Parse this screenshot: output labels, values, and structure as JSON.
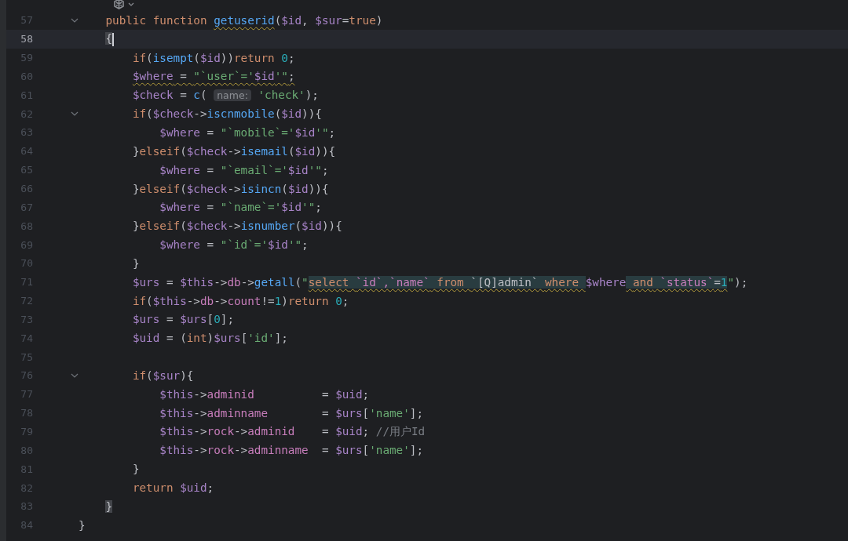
{
  "editor": {
    "lines": [
      {
        "number": "57",
        "current": false,
        "foldable": true,
        "tokens": [
          {
            "kind": "kw",
            "text": "    public function "
          },
          {
            "kind": "squiggle",
            "tokens": [
              {
                "kind": "fn",
                "text": "getuserid"
              }
            ]
          },
          {
            "kind": "plain",
            "text": "("
          },
          {
            "kind": "var",
            "text": "$id"
          },
          {
            "kind": "plain",
            "text": ", "
          },
          {
            "kind": "var",
            "text": "$sur"
          },
          {
            "kind": "plain",
            "text": "="
          },
          {
            "kind": "kw",
            "text": "true"
          },
          {
            "kind": "plain",
            "text": ")"
          }
        ]
      },
      {
        "number": "58",
        "current": true,
        "foldable": false,
        "tokens": [
          {
            "kind": "brace",
            "text": "    {"
          }
        ]
      },
      {
        "number": "59",
        "current": false,
        "foldable": false,
        "tokens": [
          {
            "kind": "kw",
            "text": "        if"
          },
          {
            "kind": "plain",
            "text": "("
          },
          {
            "kind": "fn",
            "text": "isempt"
          },
          {
            "kind": "plain",
            "text": "("
          },
          {
            "kind": "var",
            "text": "$id"
          },
          {
            "kind": "plain",
            "text": "))"
          },
          {
            "kind": "kw",
            "text": "return "
          },
          {
            "kind": "num",
            "text": "0"
          },
          {
            "kind": "plain",
            "text": ";"
          }
        ]
      },
      {
        "number": "60",
        "current": false,
        "foldable": false,
        "tokens": [
          {
            "kind": "squiggle",
            "tokens": [
              {
                "kind": "var",
                "text": "        $where"
              },
              {
                "kind": "plain",
                "text": " = "
              },
              {
                "kind": "str",
                "text": "\"`user`='"
              },
              {
                "kind": "var",
                "text": "$id"
              },
              {
                "kind": "str",
                "text": "'\""
              },
              {
                "kind": "plain",
                "text": ";"
              }
            ]
          }
        ]
      },
      {
        "number": "61",
        "current": false,
        "foldable": false,
        "tokens": [
          {
            "kind": "var",
            "text": "        $check"
          },
          {
            "kind": "plain",
            "text": " = "
          },
          {
            "kind": "fn",
            "text": "c"
          },
          {
            "kind": "plain",
            "text": "( "
          },
          {
            "kind": "hint",
            "text": "name:"
          },
          {
            "kind": "str",
            "text": " 'check'"
          },
          {
            "kind": "plain",
            "text": ");"
          }
        ]
      },
      {
        "number": "62",
        "current": false,
        "foldable": true,
        "tokens": [
          {
            "kind": "kw",
            "text": "        if"
          },
          {
            "kind": "plain",
            "text": "("
          },
          {
            "kind": "var",
            "text": "$check"
          },
          {
            "kind": "plain",
            "text": "->"
          },
          {
            "kind": "fn",
            "text": "iscnmobile"
          },
          {
            "kind": "plain",
            "text": "("
          },
          {
            "kind": "var",
            "text": "$id"
          },
          {
            "kind": "plain",
            "text": ")){"
          }
        ]
      },
      {
        "number": "63",
        "current": false,
        "foldable": false,
        "tokens": [
          {
            "kind": "var",
            "text": "            $where"
          },
          {
            "kind": "plain",
            "text": " = "
          },
          {
            "kind": "str",
            "text": "\"`mobile`='"
          },
          {
            "kind": "var",
            "text": "$id"
          },
          {
            "kind": "str",
            "text": "'\""
          },
          {
            "kind": "plain",
            "text": ";"
          }
        ]
      },
      {
        "number": "64",
        "current": false,
        "foldable": false,
        "tokens": [
          {
            "kind": "plain",
            "text": "        }"
          },
          {
            "kind": "kw",
            "text": "elseif"
          },
          {
            "kind": "plain",
            "text": "("
          },
          {
            "kind": "var",
            "text": "$check"
          },
          {
            "kind": "plain",
            "text": "->"
          },
          {
            "kind": "fn",
            "text": "isemail"
          },
          {
            "kind": "plain",
            "text": "("
          },
          {
            "kind": "var",
            "text": "$id"
          },
          {
            "kind": "plain",
            "text": ")){"
          }
        ]
      },
      {
        "number": "65",
        "current": false,
        "foldable": false,
        "tokens": [
          {
            "kind": "var",
            "text": "            $where"
          },
          {
            "kind": "plain",
            "text": " = "
          },
          {
            "kind": "str",
            "text": "\"`email`='"
          },
          {
            "kind": "var",
            "text": "$id"
          },
          {
            "kind": "str",
            "text": "'\""
          },
          {
            "kind": "plain",
            "text": ";"
          }
        ]
      },
      {
        "number": "66",
        "current": false,
        "foldable": false,
        "tokens": [
          {
            "kind": "plain",
            "text": "        }"
          },
          {
            "kind": "kw",
            "text": "elseif"
          },
          {
            "kind": "plain",
            "text": "("
          },
          {
            "kind": "var",
            "text": "$check"
          },
          {
            "kind": "plain",
            "text": "->"
          },
          {
            "kind": "fn",
            "text": "isincn"
          },
          {
            "kind": "plain",
            "text": "("
          },
          {
            "kind": "var",
            "text": "$id"
          },
          {
            "kind": "plain",
            "text": ")){"
          }
        ]
      },
      {
        "number": "67",
        "current": false,
        "foldable": false,
        "tokens": [
          {
            "kind": "var",
            "text": "            $where"
          },
          {
            "kind": "plain",
            "text": " = "
          },
          {
            "kind": "str",
            "text": "\"`name`='"
          },
          {
            "kind": "var",
            "text": "$id"
          },
          {
            "kind": "str",
            "text": "'\""
          },
          {
            "kind": "plain",
            "text": ";"
          }
        ]
      },
      {
        "number": "68",
        "current": false,
        "foldable": false,
        "tokens": [
          {
            "kind": "plain",
            "text": "        }"
          },
          {
            "kind": "kw",
            "text": "elseif"
          },
          {
            "kind": "plain",
            "text": "("
          },
          {
            "kind": "var",
            "text": "$check"
          },
          {
            "kind": "plain",
            "text": "->"
          },
          {
            "kind": "fn",
            "text": "isnumber"
          },
          {
            "kind": "plain",
            "text": "("
          },
          {
            "kind": "var",
            "text": "$id"
          },
          {
            "kind": "plain",
            "text": ")){"
          }
        ]
      },
      {
        "number": "69",
        "current": false,
        "foldable": false,
        "tokens": [
          {
            "kind": "var",
            "text": "            $where"
          },
          {
            "kind": "plain",
            "text": " = "
          },
          {
            "kind": "str",
            "text": "\"`id`='"
          },
          {
            "kind": "var",
            "text": "$id"
          },
          {
            "kind": "str",
            "text": "'\""
          },
          {
            "kind": "plain",
            "text": ";"
          }
        ]
      },
      {
        "number": "70",
        "current": false,
        "foldable": false,
        "tokens": [
          {
            "kind": "plain",
            "text": "        }"
          }
        ]
      },
      {
        "number": "71",
        "current": false,
        "foldable": false,
        "tokens": [
          {
            "kind": "var",
            "text": "        $urs"
          },
          {
            "kind": "plain",
            "text": " = "
          },
          {
            "kind": "var",
            "text": "$this"
          },
          {
            "kind": "plain",
            "text": "->"
          },
          {
            "kind": "prop",
            "text": "db"
          },
          {
            "kind": "plain",
            "text": "->"
          },
          {
            "kind": "fn",
            "text": "getall"
          },
          {
            "kind": "plain",
            "text": "("
          },
          {
            "kind": "str",
            "text": "\""
          },
          {
            "kind": "injection",
            "tokens": [
              {
                "kind": "kw",
                "text": "select"
              },
              {
                "kind": "prop",
                "text": " `id`,`name`"
              },
              {
                "kind": "kw",
                "text": " from"
              },
              {
                "kind": "plain",
                "text": " `[Q]admin` "
              },
              {
                "kind": "kw",
                "text": "where "
              }
            ]
          },
          {
            "kind": "var",
            "text": "$where"
          },
          {
            "kind": "injection",
            "tokens": [
              {
                "kind": "kw",
                "text": " and"
              },
              {
                "kind": "prop",
                "text": " `status`"
              },
              {
                "kind": "plain",
                "text": "="
              },
              {
                "kind": "num",
                "text": "1"
              }
            ]
          },
          {
            "kind": "str",
            "text": "\""
          },
          {
            "kind": "plain",
            "text": ");"
          }
        ]
      },
      {
        "number": "72",
        "current": false,
        "foldable": false,
        "tokens": [
          {
            "kind": "kw",
            "text": "        if"
          },
          {
            "kind": "plain",
            "text": "("
          },
          {
            "kind": "var",
            "text": "$this"
          },
          {
            "kind": "plain",
            "text": "->"
          },
          {
            "kind": "prop",
            "text": "db"
          },
          {
            "kind": "plain",
            "text": "->"
          },
          {
            "kind": "prop",
            "text": "count"
          },
          {
            "kind": "plain",
            "text": "!="
          },
          {
            "kind": "num",
            "text": "1"
          },
          {
            "kind": "plain",
            "text": ")"
          },
          {
            "kind": "kw",
            "text": "return "
          },
          {
            "kind": "num",
            "text": "0"
          },
          {
            "kind": "plain",
            "text": ";"
          }
        ]
      },
      {
        "number": "73",
        "current": false,
        "foldable": false,
        "tokens": [
          {
            "kind": "var",
            "text": "        $urs"
          },
          {
            "kind": "plain",
            "text": " = "
          },
          {
            "kind": "var",
            "text": "$urs"
          },
          {
            "kind": "plain",
            "text": "["
          },
          {
            "kind": "num",
            "text": "0"
          },
          {
            "kind": "plain",
            "text": "];"
          }
        ]
      },
      {
        "number": "74",
        "current": false,
        "foldable": false,
        "tokens": [
          {
            "kind": "var",
            "text": "        $uid"
          },
          {
            "kind": "plain",
            "text": " = ("
          },
          {
            "kind": "kw",
            "text": "int"
          },
          {
            "kind": "plain",
            "text": ")"
          },
          {
            "kind": "var",
            "text": "$urs"
          },
          {
            "kind": "plain",
            "text": "["
          },
          {
            "kind": "str",
            "text": "'id'"
          },
          {
            "kind": "plain",
            "text": "];"
          }
        ]
      },
      {
        "number": "75",
        "current": false,
        "foldable": false
      },
      {
        "number": "76",
        "current": false,
        "foldable": true,
        "tokens": [
          {
            "kind": "kw",
            "text": "        if"
          },
          {
            "kind": "plain",
            "text": "("
          },
          {
            "kind": "var",
            "text": "$sur"
          },
          {
            "kind": "plain",
            "text": "){"
          }
        ]
      },
      {
        "number": "77",
        "current": false,
        "foldable": false,
        "tokens": [
          {
            "kind": "var",
            "text": "            $this"
          },
          {
            "kind": "plain",
            "text": "->"
          },
          {
            "kind": "prop",
            "text": "adminid"
          },
          {
            "kind": "plain",
            "text": "          = "
          },
          {
            "kind": "var",
            "text": "$uid"
          },
          {
            "kind": "plain",
            "text": ";"
          }
        ]
      },
      {
        "number": "78",
        "current": false,
        "foldable": false,
        "tokens": [
          {
            "kind": "var",
            "text": "            $this"
          },
          {
            "kind": "plain",
            "text": "->"
          },
          {
            "kind": "prop",
            "text": "adminname"
          },
          {
            "kind": "plain",
            "text": "        = "
          },
          {
            "kind": "var",
            "text": "$urs"
          },
          {
            "kind": "plain",
            "text": "["
          },
          {
            "kind": "str",
            "text": "'name'"
          },
          {
            "kind": "plain",
            "text": "];"
          }
        ]
      },
      {
        "number": "79",
        "current": false,
        "foldable": false,
        "tokens": [
          {
            "kind": "var",
            "text": "            $this"
          },
          {
            "kind": "plain",
            "text": "->"
          },
          {
            "kind": "prop",
            "text": "rock"
          },
          {
            "kind": "plain",
            "text": "->"
          },
          {
            "kind": "prop",
            "text": "adminid"
          },
          {
            "kind": "plain",
            "text": "    = "
          },
          {
            "kind": "var",
            "text": "$uid"
          },
          {
            "kind": "plain",
            "text": "; "
          },
          {
            "kind": "comment",
            "text": "//用户Id"
          }
        ]
      },
      {
        "number": "80",
        "current": false,
        "foldable": false,
        "tokens": [
          {
            "kind": "var",
            "text": "            $this"
          },
          {
            "kind": "plain",
            "text": "->"
          },
          {
            "kind": "prop",
            "text": "rock"
          },
          {
            "kind": "plain",
            "text": "->"
          },
          {
            "kind": "prop",
            "text": "adminname"
          },
          {
            "kind": "plain",
            "text": "  = "
          },
          {
            "kind": "var",
            "text": "$urs"
          },
          {
            "kind": "plain",
            "text": "["
          },
          {
            "kind": "str",
            "text": "'name'"
          },
          {
            "kind": "plain",
            "text": "];"
          }
        ]
      },
      {
        "number": "81",
        "current": false,
        "foldable": false,
        "tokens": [
          {
            "kind": "plain",
            "text": "        }"
          }
        ]
      },
      {
        "number": "82",
        "current": false,
        "foldable": false,
        "tokens": [
          {
            "kind": "kw",
            "text": "        return "
          },
          {
            "kind": "var",
            "text": "$uid"
          },
          {
            "kind": "plain",
            "text": ";"
          }
        ]
      },
      {
        "number": "83",
        "current": false,
        "foldable": false,
        "tokens": [
          {
            "kind": "brace",
            "text": "    }"
          }
        ]
      },
      {
        "number": "84",
        "current": false,
        "foldable": false,
        "tokens": [
          {
            "kind": "plain",
            "text": "}"
          }
        ]
      }
    ]
  }
}
